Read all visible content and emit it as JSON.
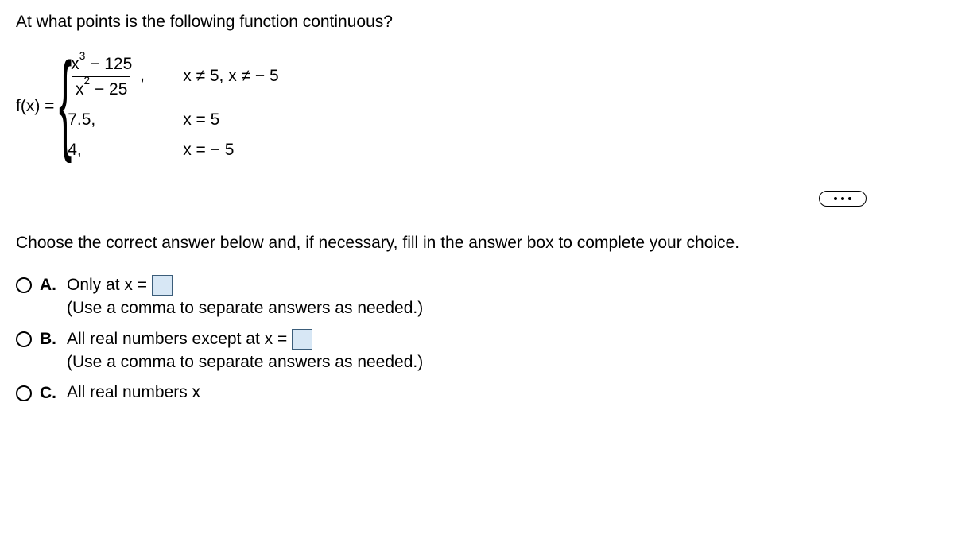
{
  "question": "At what points is the following function continuous?",
  "fn": {
    "lhs": "f(x) =",
    "cases": [
      {
        "numer": "x³ − 125",
        "denom": "x² − 25",
        "suffix": ",",
        "cond": "x ≠ 5, x ≠ − 5"
      },
      {
        "expr": "7.5,",
        "cond": "x = 5"
      },
      {
        "expr": "4,",
        "cond": "x = − 5"
      }
    ]
  },
  "instruction": "Choose the correct answer below and, if necessary, fill in the answer box to complete your choice.",
  "choices": {
    "A": {
      "label": "A.",
      "text_before": "Only at x =",
      "hint": "(Use a comma to separate answers as needed.)"
    },
    "B": {
      "label": "B.",
      "text_before": "All real numbers except at x =",
      "hint": "(Use a comma to separate answers as needed.)"
    },
    "C": {
      "label": "C.",
      "text": "All real numbers x"
    }
  }
}
